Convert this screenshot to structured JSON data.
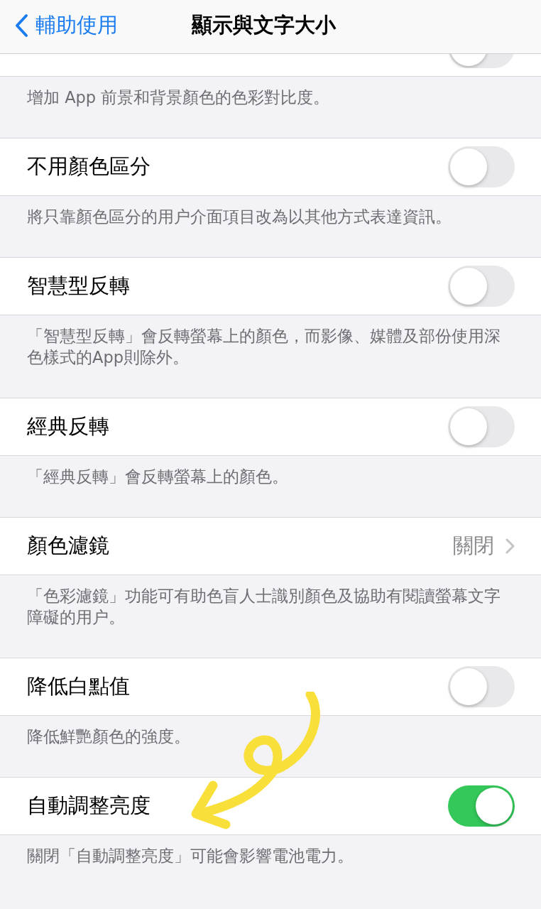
{
  "nav": {
    "back": "輔助使用",
    "title": "顯示與文字大小"
  },
  "sections": [
    {
      "kind": "toggle",
      "on": false,
      "footer": "增加 App 前景和背景顏色的色彩對比度。"
    },
    {
      "kind": "toggle",
      "label": "不用顏色區分",
      "on": false,
      "footer": "將只靠顏色區分的用户介面項目改為以其他方式表達資訊。"
    },
    {
      "kind": "toggle",
      "label": "智慧型反轉",
      "on": false,
      "footer": "「智慧型反轉」會反轉螢幕上的顏色，而影像、媒體及部份使用深色樣式的App則除外。"
    },
    {
      "kind": "toggle",
      "label": "經典反轉",
      "on": false,
      "footer": "「經典反轉」會反轉螢幕上的顏色。"
    },
    {
      "kind": "link",
      "label": "顏色濾鏡",
      "value": "關閉",
      "footer": "「色彩濾鏡」功能可有助色盲人士識別顏色及協助有閱讀螢幕文字障礙的用户。"
    },
    {
      "kind": "toggle",
      "label": "降低白點值",
      "on": false,
      "footer": "降低鮮艷顏色的強度。"
    },
    {
      "kind": "toggle",
      "label": "自動調整亮度",
      "on": true,
      "footer": "關閉「自動調整亮度」可能會影響電池電力。"
    }
  ]
}
